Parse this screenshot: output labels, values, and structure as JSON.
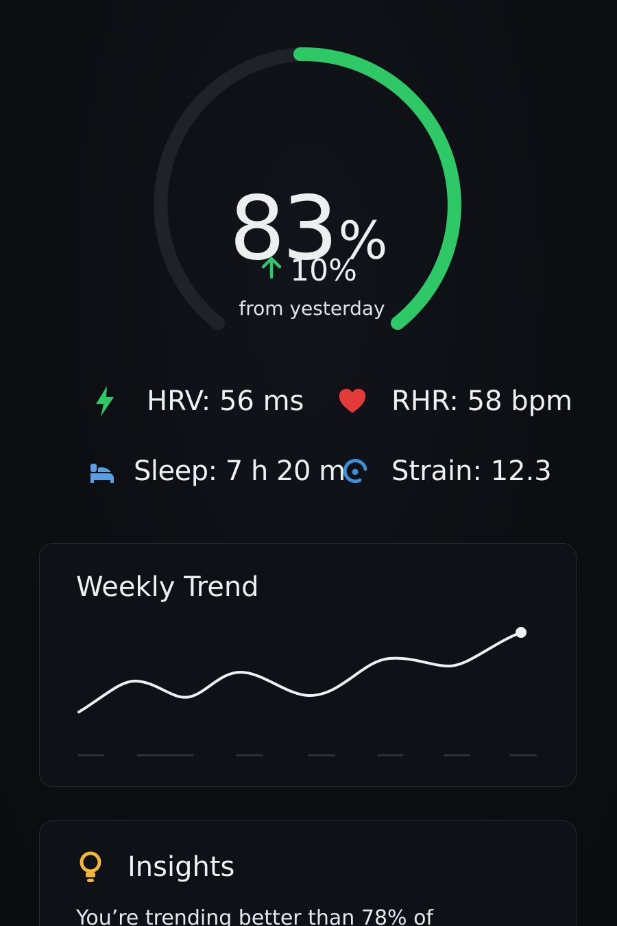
{
  "recovery": {
    "score": "83",
    "unit": "%",
    "progress_percent": 83,
    "delta": "10%",
    "delta_caption": "from yesterday",
    "colors": {
      "track": "#1f2329",
      "progress": "#2ec866",
      "up_arrow": "#2ec866"
    }
  },
  "metrics": {
    "hrv": {
      "icon": "lightning-icon",
      "label": "HRV: 56 ms",
      "color": "#2ec866"
    },
    "rhr": {
      "icon": "heart-icon",
      "label": "RHR: 58 bpm",
      "color": "#e53a3a"
    },
    "sleep": {
      "icon": "bed-icon",
      "label": "Sleep: 7 h 20 m",
      "color": "#5aa0e0"
    },
    "strain": {
      "icon": "strain-gauge-icon",
      "label": "Strain: 12.3",
      "color": "#3d8fd6"
    }
  },
  "weekly_trend": {
    "title": "Weekly Trend",
    "line_color": "#eef0f2"
  },
  "insights": {
    "icon": "lightbulb-icon",
    "icon_color": "#f2b63a",
    "title": "Insights",
    "text": "You’re trending better than 78% of"
  }
}
